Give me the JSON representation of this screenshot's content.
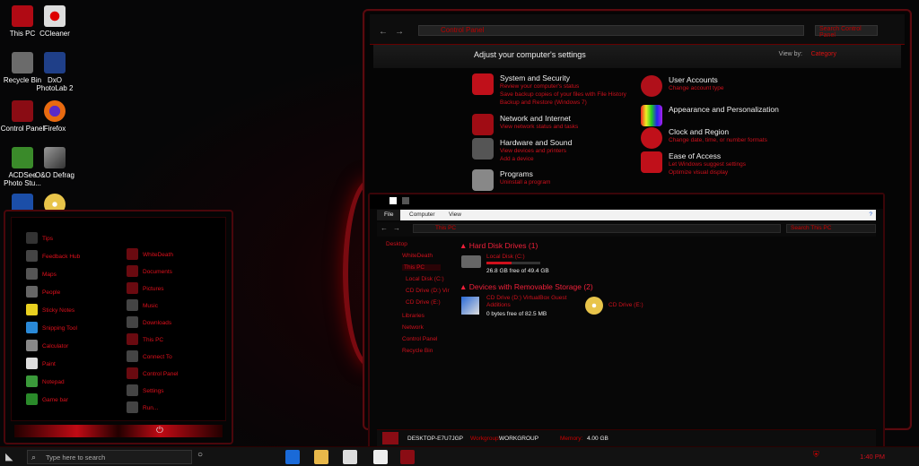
{
  "desktop": {
    "icons": [
      {
        "label": "This PC",
        "color": "#c0101a"
      },
      {
        "label": "CCleaner",
        "color": "#d8d8d8"
      },
      {
        "label": "Recycle Bin",
        "color": "#777777"
      },
      {
        "label": "DxO PhotoLab 2",
        "color": "#1f3f88"
      },
      {
        "label": "Control Panel",
        "color": "#9a1018"
      },
      {
        "label": "Firefox",
        "color": "#e86a10"
      },
      {
        "label": "ACDSee Photo Stu...",
        "color": "#3a8a2a"
      },
      {
        "label": "O&O Defrag",
        "color": "#cccccc"
      }
    ]
  },
  "control_panel": {
    "address": "Control Panel",
    "search_placeholder": "Search Control Panel",
    "heading": "Adjust your computer's settings",
    "view_by_label": "View by:",
    "view_by_value": "Category",
    "categories": [
      {
        "name": "System and Security",
        "subs": [
          "Review your computer's status",
          "Save backup copies of your files with File History",
          "Backup and Restore (Windows 7)"
        ],
        "color": "#c0101a",
        "icon": "shield-icon"
      },
      {
        "name": "Network and Internet",
        "subs": [
          "View network status and tasks"
        ],
        "color": "#a00c14",
        "icon": "network-icon"
      },
      {
        "name": "Hardware and Sound",
        "subs": [
          "View devices and printers",
          "Add a device"
        ],
        "color": "#555555",
        "icon": "printer-icon"
      },
      {
        "name": "Programs",
        "subs": [
          "Uninstall a program"
        ],
        "color": "#888888",
        "icon": "programs-icon"
      },
      {
        "name": "User Accounts",
        "subs": [
          "Change account type"
        ],
        "color": "#b0101a",
        "icon": "user-icon"
      },
      {
        "name": "Appearance and Personalization",
        "subs": [],
        "color": "#6a2a9a",
        "icon": "palette-icon"
      },
      {
        "name": "Clock and Region",
        "subs": [
          "Change date, time, or number formats"
        ],
        "color": "#c0101a",
        "icon": "clock-icon"
      },
      {
        "name": "Ease of Access",
        "subs": [
          "Let Windows suggest settings",
          "Optimize visual display"
        ],
        "color": "#c0101a",
        "icon": "accessibility-icon"
      }
    ]
  },
  "explorer": {
    "tabs": [
      "File",
      "Computer",
      "View"
    ],
    "address": "This PC",
    "search_placeholder": "Search This PC",
    "tree": [
      "Desktop",
      "WhiteDeath",
      "This PC",
      "Local Disk (C:)",
      "CD Drive (D:) Vir",
      "CD Drive (E:)",
      "Libraries",
      "Network",
      "Control Panel",
      "Recycle Bin"
    ],
    "section_hdd": "Hard Disk Drives (1)",
    "section_removable": "Devices with Removable Storage (2)",
    "drives": {
      "c_name": "Local Disk (C:)",
      "c_free": "26.8 GB free of 49.4 GB",
      "c_used_fraction": 0.46,
      "d_name": "CD Drive (D:) VirtualBox Guest Additions",
      "d_free": "0 bytes free of 82.5 MB",
      "e_name": "CD Drive (E:)"
    },
    "status": {
      "computer": "DESKTOP-E7U7JGP",
      "workgroup_label": "Workgroup:",
      "workgroup": "WORKGROUP",
      "memory_label": "Memory:",
      "memory": "4.00 GB"
    }
  },
  "start_menu": {
    "left": [
      "Tips",
      "Feedback Hub",
      "Maps",
      "People",
      "Sticky Notes",
      "Snipping Tool",
      "Calculator",
      "Paint",
      "Notepad",
      "Game bar"
    ],
    "right": [
      "WhiteDeath",
      "Documents",
      "Pictures",
      "Music",
      "Downloads",
      "This PC",
      "Connect To",
      "Control Panel",
      "Settings",
      "Run..."
    ]
  },
  "taskbar": {
    "search_placeholder": "Type here to search",
    "time": "1:40 PM"
  }
}
